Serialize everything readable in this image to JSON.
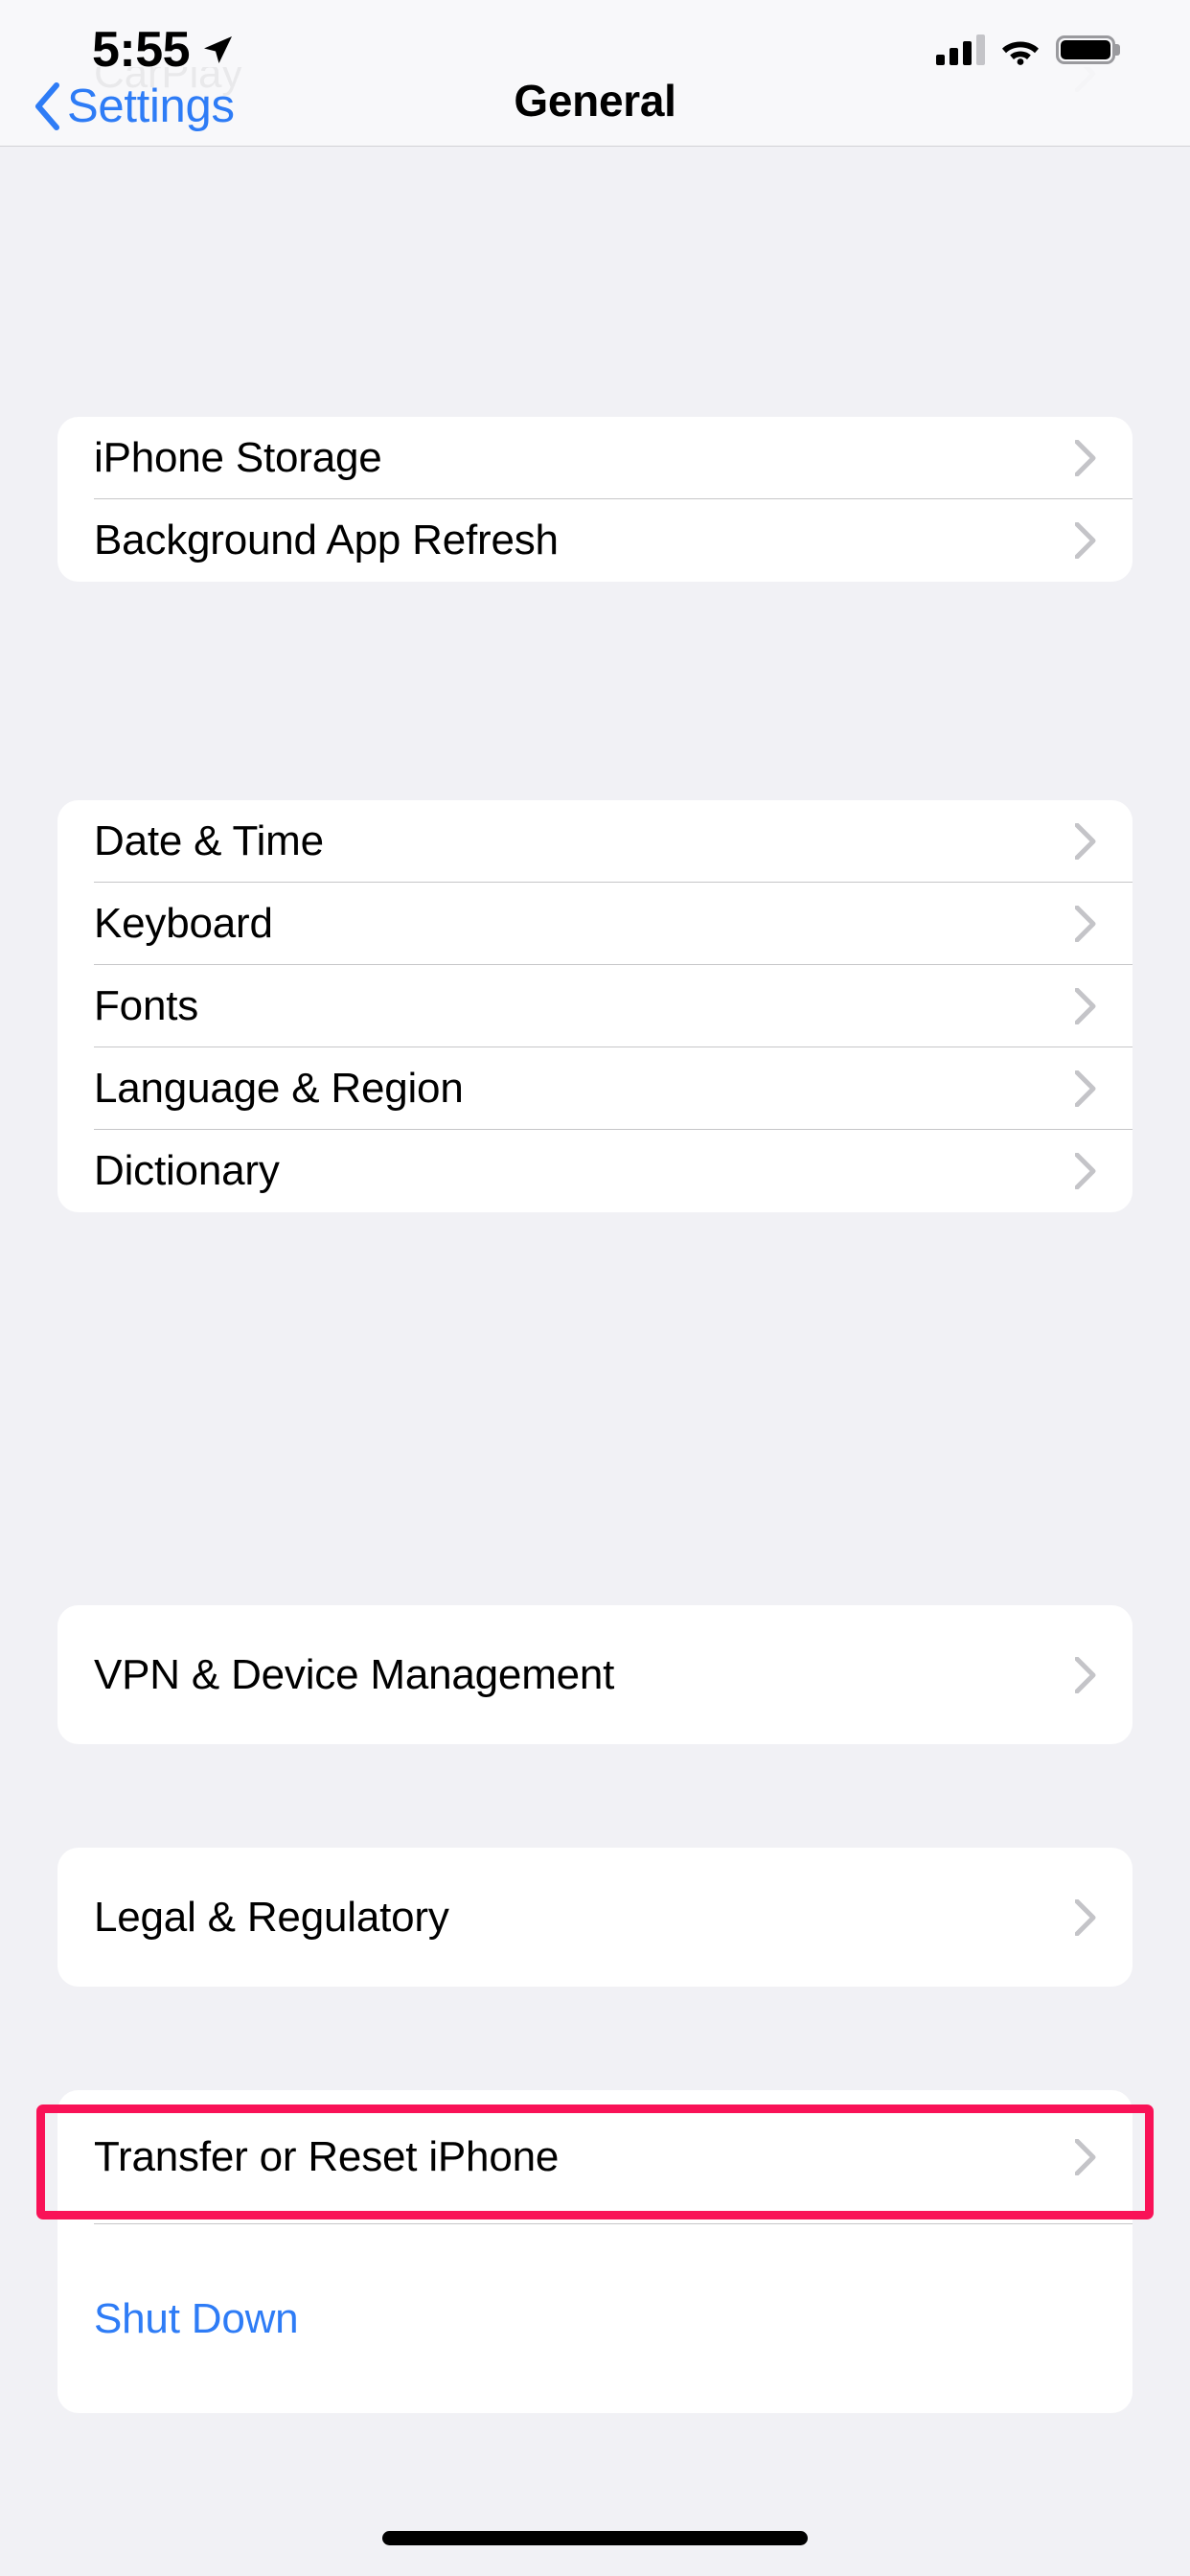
{
  "status_bar": {
    "time": "5:55",
    "location_icon": "location-arrow-icon",
    "cellular_icon": "cellular-signal-icon",
    "cellular_bars_filled": 3,
    "cellular_bars_total": 4,
    "wifi_icon": "wifi-icon",
    "battery_icon": "battery-full-icon",
    "battery_level_percent": 100
  },
  "nav_bar": {
    "back_icon": "chevron-left-icon",
    "back_label": "Settings",
    "title": "General"
  },
  "sections": [
    {
      "id": "carplay-section",
      "clipped_top": true,
      "rows": [
        {
          "label": "CarPlay",
          "accessory": "chevron-right-icon",
          "style": "default"
        }
      ]
    },
    {
      "id": "storage-section",
      "rows": [
        {
          "label": "iPhone Storage",
          "accessory": "chevron-right-icon",
          "style": "default"
        },
        {
          "label": "Background App Refresh",
          "accessory": "chevron-right-icon",
          "style": "default"
        }
      ]
    },
    {
      "id": "localization-section",
      "rows": [
        {
          "label": "Date & Time",
          "accessory": "chevron-right-icon",
          "style": "default"
        },
        {
          "label": "Keyboard",
          "accessory": "chevron-right-icon",
          "style": "default"
        },
        {
          "label": "Fonts",
          "accessory": "chevron-right-icon",
          "style": "default"
        },
        {
          "label": "Language & Region",
          "accessory": "chevron-right-icon",
          "style": "default"
        },
        {
          "label": "Dictionary",
          "accessory": "chevron-right-icon",
          "style": "default"
        }
      ]
    },
    {
      "id": "vpn-section",
      "rows": [
        {
          "label": "VPN & Device Management",
          "accessory": "chevron-right-icon",
          "style": "default"
        }
      ]
    },
    {
      "id": "legal-section",
      "rows": [
        {
          "label": "Legal & Regulatory",
          "accessory": "chevron-right-icon",
          "style": "default"
        }
      ]
    },
    {
      "id": "reset-section",
      "rows": [
        {
          "label": "Transfer or Reset iPhone",
          "accessory": "chevron-right-icon",
          "style": "default",
          "highlighted": true
        },
        {
          "label": "Shut Down",
          "accessory": "none",
          "style": "link"
        }
      ]
    }
  ],
  "annotation": {
    "type": "highlight-rectangle",
    "target_label": "Transfer or Reset iPhone",
    "color": "#F91257"
  },
  "home_indicator": {
    "name": "home-indicator"
  },
  "colors": {
    "background": "#F1F1F5",
    "card": "#FFFFFF",
    "separator": "#C6C6C8",
    "accent_blue": "#2E7CF6",
    "label": "#000000",
    "chevron_gray": "#C4C4C8",
    "highlight": "#F91257",
    "navbar": "#F8F8FA"
  }
}
